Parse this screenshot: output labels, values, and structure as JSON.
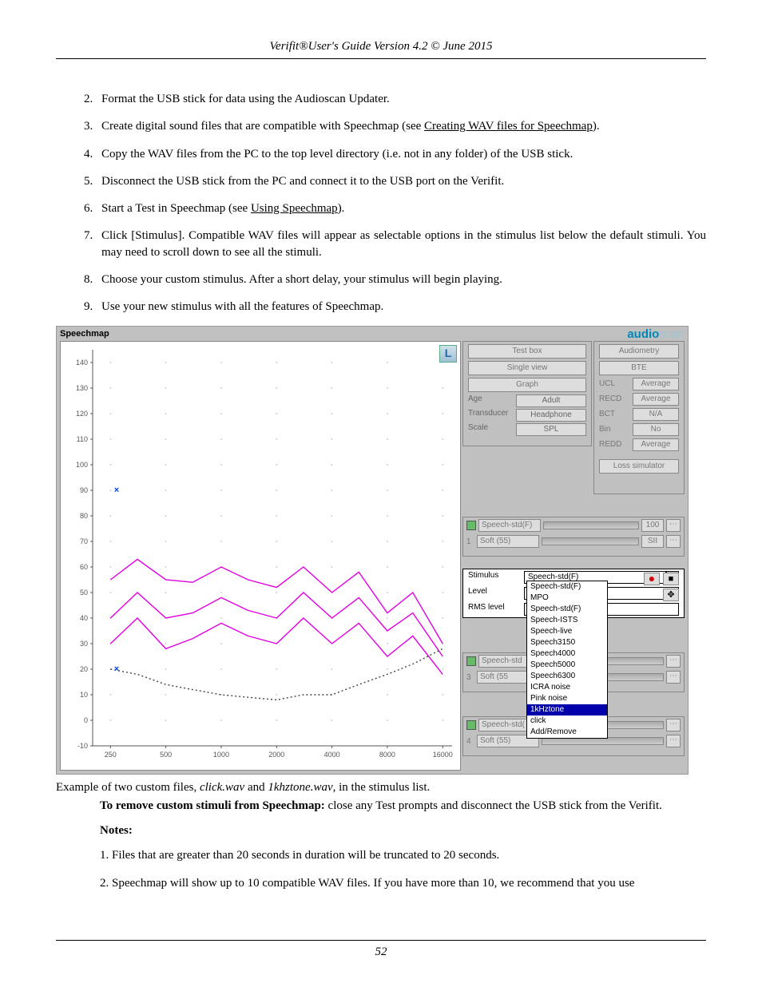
{
  "header": "Verifit®User's Guide Version 4.2 © June 2015",
  "steps": [
    {
      "n": "2.",
      "html": "Format the USB stick for data using the Audioscan Updater."
    },
    {
      "n": "3.",
      "html": "Create digital sound files that are compatible with Speechmap (see <span class=\"ul\">Creating WAV files for Speechmap</span>)."
    },
    {
      "n": "4.",
      "html": "Copy the WAV files from the PC to the top level directory (i.e. not in any folder) of the USB stick."
    },
    {
      "n": "5.",
      "html": "Disconnect the USB stick from the PC and connect it to the USB port on the Verifit."
    },
    {
      "n": "6.",
      "html": "Start a Test in Speechmap (see <span class=\"ul\">Using Speechmap</span>)."
    },
    {
      "n": "7.",
      "html": "Click [Stimulus]. Compatible WAV files will appear as selectable options in the stimulus list below the default stimuli. You may need to scroll down to see all the stimuli."
    },
    {
      "n": "8.",
      "html": "Choose your custom stimulus. After a short delay, your stimulus will begin playing."
    },
    {
      "n": "9.",
      "html": "Use your new stimulus with all the features of Speechmap."
    }
  ],
  "app": {
    "title": "Speechmap",
    "brand1": "audio",
    "brand2": "scan",
    "L": "L",
    "panel1": {
      "btns": [
        "Test box",
        "Single view",
        "Graph"
      ],
      "rows": [
        {
          "k": "Age",
          "v": "Adult"
        },
        {
          "k": "Transducer",
          "v": "Headphone"
        },
        {
          "k": "Scale",
          "v": "SPL"
        }
      ]
    },
    "panel2": {
      "btns": [
        "Audiometry",
        "BTE"
      ],
      "rows": [
        {
          "k": "UCL",
          "v": "Average"
        },
        {
          "k": "RECD",
          "v": "Average"
        },
        {
          "k": "BCT",
          "v": "N/A"
        },
        {
          "k": "Bin",
          "v": "No"
        },
        {
          "k": "REDD",
          "v": "Average"
        }
      ],
      "loss": "Loss simulator"
    },
    "stim_rows": [
      {
        "num": "",
        "field": "Speech-std(F)",
        "badge": "100"
      },
      {
        "num": "1",
        "field": "Soft (55)",
        "badge": "SII"
      },
      {
        "num": "",
        "field": "Speech-std",
        "badge": ""
      },
      {
        "num": "3",
        "field": "Soft (55",
        "badge": ""
      },
      {
        "num": "",
        "field": "Speech-std(",
        "badge": ""
      },
      {
        "num": "4",
        "field": "Soft (55)",
        "badge": ""
      }
    ],
    "stim_panel": {
      "rows": [
        {
          "k": "Stimulus",
          "v": "Speech-std(F)"
        },
        {
          "k": "Level",
          "v": "MPO"
        },
        {
          "k": "RMS level",
          "v": "Speech-std(F)"
        }
      ]
    },
    "dropdown": [
      "Speech-std(F)",
      "MPO",
      "Speech-std(F)",
      "Speech-ISTS",
      "Speech-live",
      "Speech3150",
      "Speech4000",
      "Speech5000",
      "Speech6300",
      "ICRA noise",
      "Pink noise",
      "1kHztone",
      "click",
      "Add/Remove"
    ]
  },
  "chart_data": {
    "type": "line",
    "xlabel": "",
    "ylabel": "",
    "x_ticks": [
      250,
      500,
      1000,
      2000,
      4000,
      8000,
      16000
    ],
    "y_ticks": [
      -10,
      0,
      10,
      20,
      30,
      40,
      50,
      60,
      70,
      80,
      90,
      100,
      110,
      120,
      130,
      140
    ],
    "ylim": [
      -10,
      145
    ],
    "xlim_log": [
      200,
      18000
    ],
    "series": [
      {
        "name": "upper",
        "color": "#e000e0",
        "x": [
          250,
          350,
          500,
          700,
          1000,
          1400,
          2000,
          2800,
          4000,
          5600,
          8000,
          11000,
          16000
        ],
        "y": [
          55,
          63,
          55,
          54,
          60,
          55,
          52,
          60,
          50,
          58,
          42,
          50,
          30
        ]
      },
      {
        "name": "middle",
        "color": "#e000e0",
        "x": [
          250,
          350,
          500,
          700,
          1000,
          1400,
          2000,
          2800,
          4000,
          5600,
          8000,
          11000,
          16000
        ],
        "y": [
          40,
          50,
          40,
          42,
          48,
          43,
          40,
          50,
          40,
          48,
          35,
          42,
          25
        ]
      },
      {
        "name": "lower",
        "color": "#e000e0",
        "x": [
          250,
          350,
          500,
          700,
          1000,
          1400,
          2000,
          2800,
          4000,
          5600,
          8000,
          11000,
          16000
        ],
        "y": [
          30,
          40,
          28,
          32,
          38,
          33,
          30,
          40,
          30,
          38,
          25,
          33,
          18
        ]
      },
      {
        "name": "threshold",
        "color": "#444",
        "style": "dotted",
        "x": [
          250,
          350,
          500,
          700,
          1000,
          1400,
          2000,
          2800,
          4000,
          5600,
          8000,
          11000,
          16000
        ],
        "y": [
          20,
          18,
          14,
          12,
          10,
          9,
          8,
          10,
          10,
          14,
          18,
          22,
          28
        ]
      }
    ],
    "markers": [
      {
        "x": 270,
        "y": 90,
        "sym": "x",
        "color": "#0044ee"
      },
      {
        "x": 270,
        "y": 20,
        "sym": "x",
        "color": "#0044ee"
      }
    ]
  },
  "caption": "Example of two custom files, <em>click.wav</em> and <em>1khztone.wav</em>, in the stimulus list.",
  "remove": "<strong>To remove custom stimuli from Speechmap:</strong> close any Test prompts and disconnect the USB stick from the Verifit.",
  "notes_label": "Notes:",
  "notes": [
    "1. Files that are greater than 20 seconds in duration will be truncated to 20 seconds.",
    "2. Speechmap will show up to 10 compatible WAV files. If you have more than 10, we recommend that you use"
  ],
  "page_num": "52"
}
